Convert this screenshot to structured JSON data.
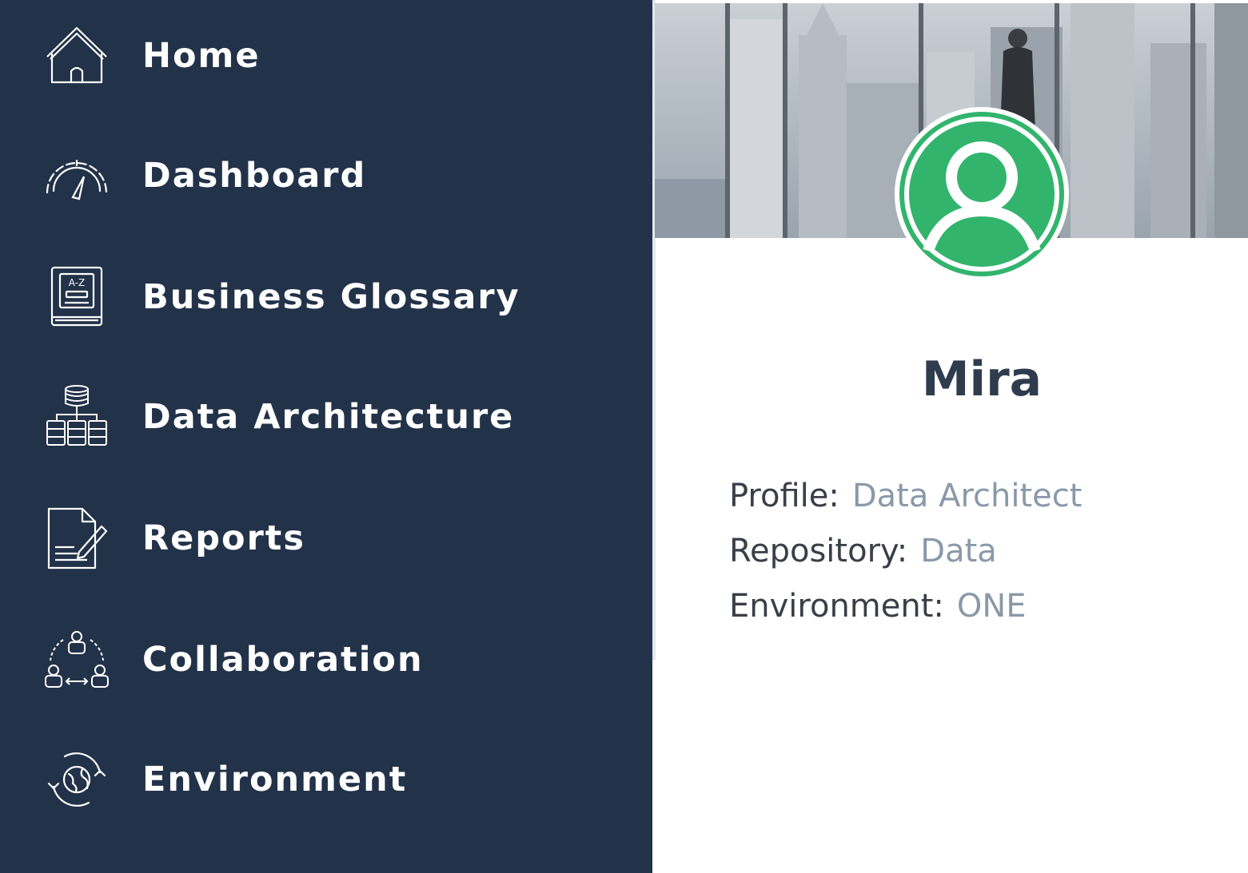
{
  "sidebar": {
    "items": [
      {
        "label": "Home",
        "icon": "home-icon"
      },
      {
        "label": "Dashboard",
        "icon": "speedometer-icon"
      },
      {
        "label": "Business Glossary",
        "icon": "glossary-book-icon"
      },
      {
        "label": "Data Architecture",
        "icon": "data-architecture-icon"
      },
      {
        "label": "Reports",
        "icon": "report-edit-icon"
      },
      {
        "label": "Collaboration",
        "icon": "collaboration-icon"
      },
      {
        "label": "Environment",
        "icon": "environment-globe-icon"
      }
    ],
    "glossary_icon_text": "A-Z",
    "background": "#223249"
  },
  "profile": {
    "name": "Mira",
    "fields": [
      {
        "key": "Profile:",
        "value": "Data Architect"
      },
      {
        "key": "Repository:",
        "value": "Data"
      },
      {
        "key": "Environment:",
        "value": "ONE"
      }
    ],
    "avatar_color": "#32b46d"
  }
}
